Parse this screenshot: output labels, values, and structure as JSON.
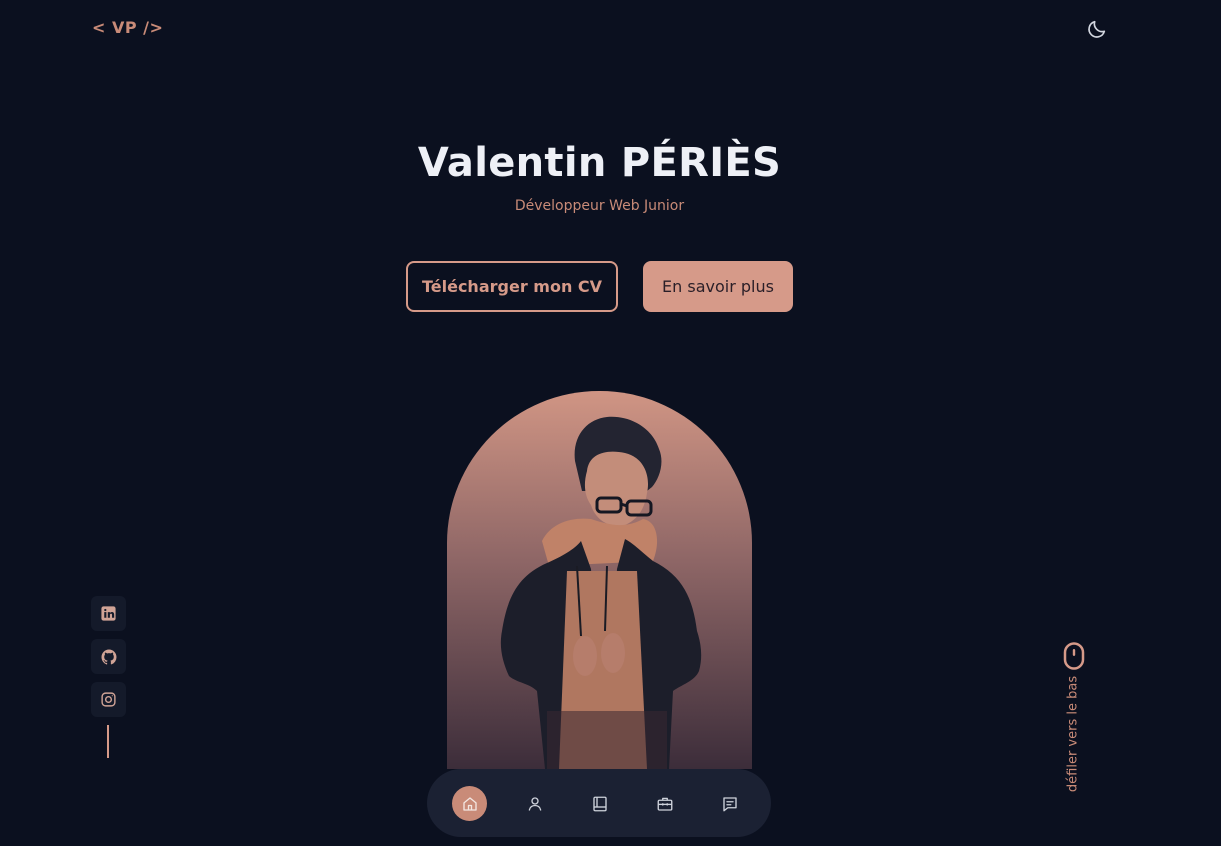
{
  "header": {
    "logo": "< VP />",
    "theme_icon": "moon-icon"
  },
  "hero": {
    "name": "Valentin PÉRIÈS",
    "role": "Développeur Web Junior",
    "download_cv_label": "Télécharger mon CV",
    "learn_more_label": "En savoir plus"
  },
  "socials": [
    {
      "name": "linkedin-icon"
    },
    {
      "name": "github-icon"
    },
    {
      "name": "instagram-icon"
    }
  ],
  "scroll": {
    "label": "défiler vers le bas",
    "icon": "mouse-icon"
  },
  "nav": {
    "items": [
      {
        "icon": "home-icon",
        "active": true
      },
      {
        "icon": "user-icon",
        "active": false
      },
      {
        "icon": "book-icon",
        "active": false
      },
      {
        "icon": "briefcase-icon",
        "active": false
      },
      {
        "icon": "message-icon",
        "active": false
      }
    ]
  },
  "colors": {
    "background": "#0b101f",
    "accent": "#d69a89",
    "text": "#eef0f6",
    "nav_bg": "#1b2133"
  }
}
